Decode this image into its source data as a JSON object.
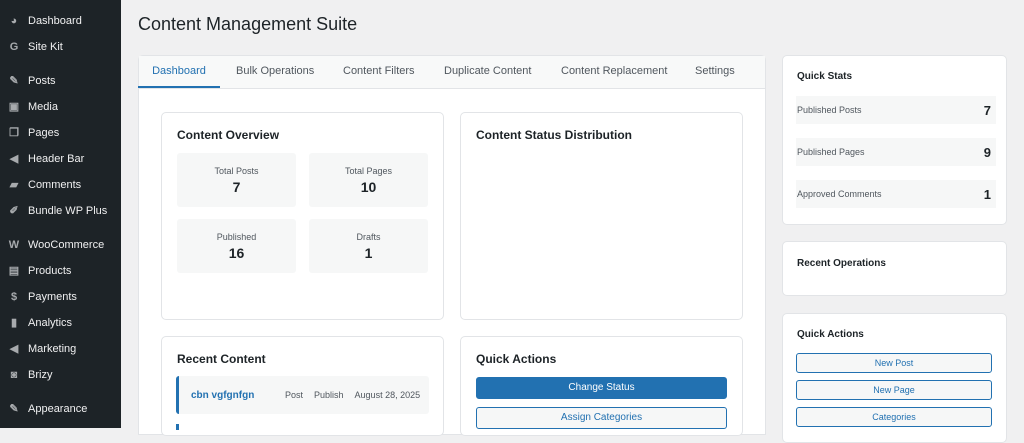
{
  "sidebar": [
    {
      "label": "Dashboard",
      "icon": "dashboard-icon",
      "g": "◕"
    },
    {
      "label": "Site Kit",
      "icon": "google-icon",
      "g": "G"
    },
    {
      "label": "Posts",
      "icon": "pin-icon",
      "g": "✎"
    },
    {
      "label": "Media",
      "icon": "media-icon",
      "g": "▣"
    },
    {
      "label": "Pages",
      "icon": "pages-icon",
      "g": "❐"
    },
    {
      "label": "Header Bar",
      "icon": "megaphone-icon",
      "g": "◀"
    },
    {
      "label": "Comments",
      "icon": "comment-icon",
      "g": "▰"
    },
    {
      "label": "Bundle WP Plus",
      "icon": "plugin-icon",
      "g": "✐"
    },
    {
      "label": "WooCommerce",
      "icon": "woo-icon",
      "g": "W"
    },
    {
      "label": "Products",
      "icon": "archive-icon",
      "g": "▤"
    },
    {
      "label": "Payments",
      "icon": "dollar-icon",
      "g": "$"
    },
    {
      "label": "Analytics",
      "icon": "bar-chart-icon",
      "g": "▮"
    },
    {
      "label": "Marketing",
      "icon": "megaphone-icon",
      "g": "◀"
    },
    {
      "label": "Brizy",
      "icon": "brizy-icon",
      "g": "◙"
    },
    {
      "label": "Appearance",
      "icon": "brush-icon",
      "g": "✎"
    }
  ],
  "title": "Content Management Suite",
  "tabs": [
    "Dashboard",
    "Bulk Operations",
    "Content Filters",
    "Duplicate Content",
    "Content Replacement",
    "Settings"
  ],
  "overview": {
    "title": "Content Overview",
    "stats": [
      {
        "label": "Total Posts",
        "value": "7"
      },
      {
        "label": "Total Pages",
        "value": "10"
      },
      {
        "label": "Published",
        "value": "16"
      },
      {
        "label": "Drafts",
        "value": "1"
      }
    ]
  },
  "distribution_title": "Content Status Distribution",
  "recent": {
    "title": "Recent Content",
    "items": [
      {
        "title": "cbn vgfgnfgn",
        "type": "Post",
        "status": "Publish",
        "date": "August 28, 2025"
      }
    ]
  },
  "quick_actions": {
    "title": "Quick Actions",
    "buttons": [
      "Change Status",
      "Assign Categories"
    ]
  },
  "quick_stats": {
    "title": "Quick Stats",
    "items": [
      {
        "label": "Published Posts",
        "value": "7"
      },
      {
        "label": "Published Pages",
        "value": "9"
      },
      {
        "label": "Approved Comments",
        "value": "1"
      }
    ]
  },
  "recent_operations": "Recent Operations",
  "side_actions": {
    "title": "Quick Actions",
    "buttons": [
      "New Post",
      "New Page",
      "Categories"
    ]
  }
}
